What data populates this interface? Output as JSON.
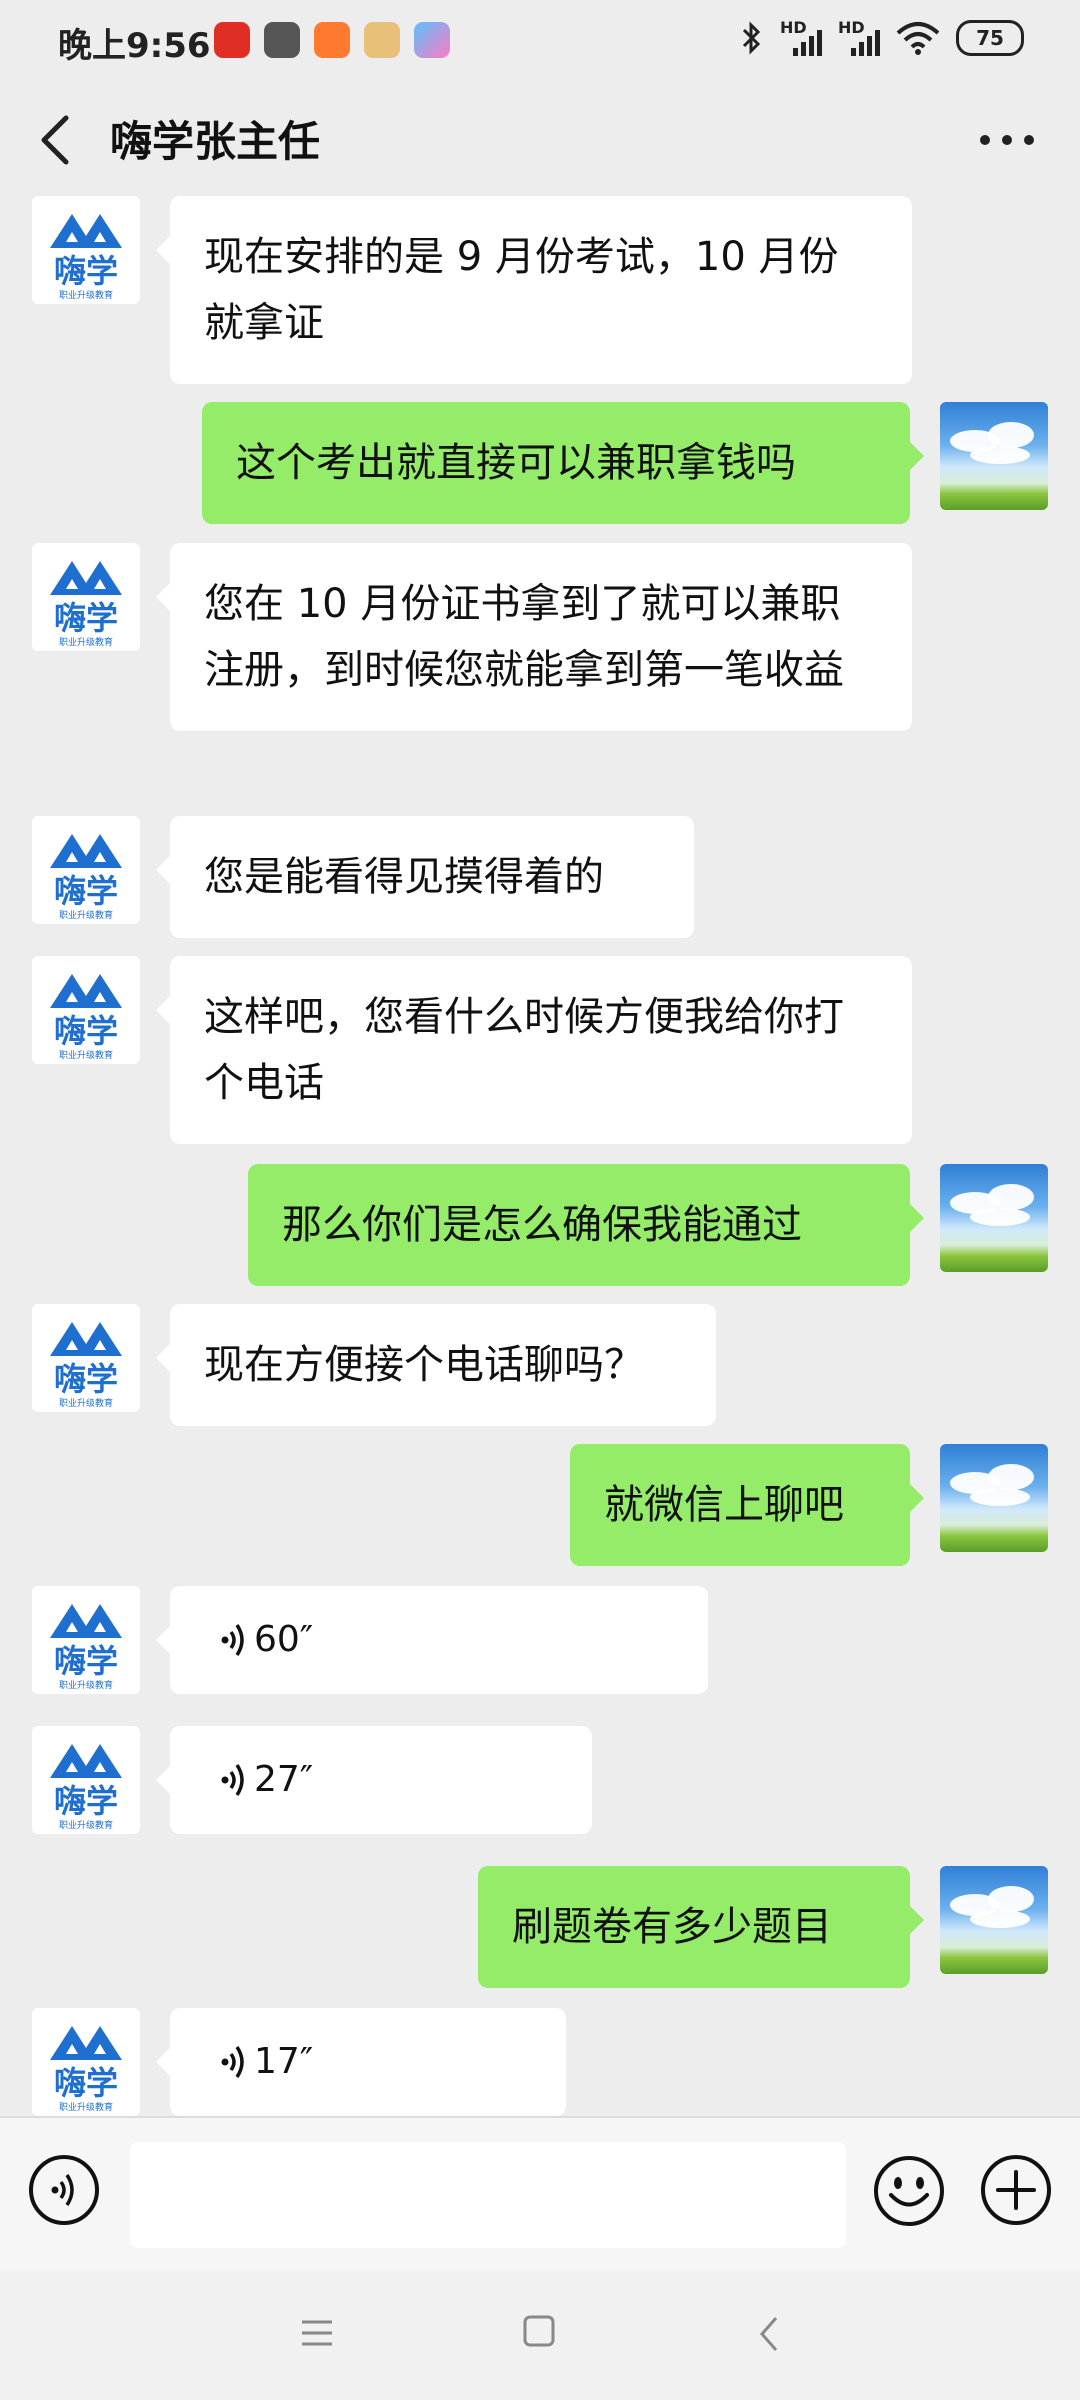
{
  "status_bar": {
    "time": "晚上9:56",
    "signal_label_1": "HD",
    "signal_label_2": "HD",
    "battery": "75",
    "app_icons": [
      "pinduoduo-icon",
      "mi-icon",
      "orange-app-icon",
      "game-center-icon",
      "gamepad-icon"
    ]
  },
  "header": {
    "title": "嗨学张主任",
    "back_icon": "chevron-left-icon",
    "more_icon": "more-dots-icon"
  },
  "avatar_left": {
    "logo_text": "嗨学",
    "logo_subtext": "职业升级教育"
  },
  "messages": [
    {
      "side": "left",
      "type": "text",
      "text": "现在安排的是 9 月份考试，10 月份就拿证"
    },
    {
      "side": "right",
      "type": "text",
      "text": "这个考出就直接可以兼职拿钱吗"
    },
    {
      "side": "left",
      "type": "text",
      "text": "您在 10 月份证书拿到了就可以兼职注册，到时候您就能拿到第一笔收益"
    },
    {
      "side": "left",
      "type": "text",
      "text": "您是能看得见摸得着的"
    },
    {
      "side": "left",
      "type": "text",
      "text": "这样吧，您看什么时候方便我给你打个电话"
    },
    {
      "side": "right",
      "type": "text",
      "text": "那么你们是怎么确保我能通过"
    },
    {
      "side": "left",
      "type": "text",
      "text": "现在方便接个电话聊吗？"
    },
    {
      "side": "right",
      "type": "text",
      "text": "就微信上聊吧"
    },
    {
      "side": "left",
      "type": "voice",
      "text": "60″"
    },
    {
      "side": "left",
      "type": "voice",
      "text": "27″"
    },
    {
      "side": "right",
      "type": "text",
      "text": "刷题卷有多少题目"
    },
    {
      "side": "left",
      "type": "voice",
      "text": "17″"
    }
  ],
  "input_bar": {
    "voice_icon": "voice-input-icon",
    "placeholder": "",
    "emoji_icon": "emoji-icon",
    "plus_icon": "plus-icon"
  },
  "colors": {
    "background": "#ededed",
    "bubble_self": "#95ec69",
    "bubble_other": "#ffffff",
    "logo_blue": "#1f6fd0"
  }
}
